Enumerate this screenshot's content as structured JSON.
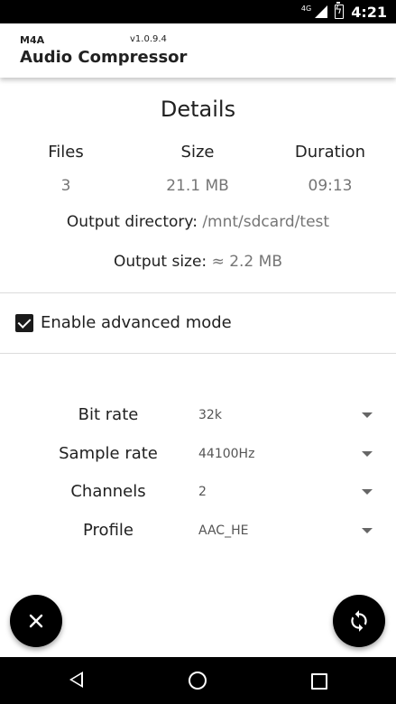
{
  "status_bar": {
    "network": "4G",
    "time": "4:21"
  },
  "app_bar": {
    "subtitle": "M4A",
    "version": "v1.0.9.4",
    "title": "Audio Compressor"
  },
  "details": {
    "heading": "Details",
    "stats": [
      {
        "label": "Files",
        "value": "3"
      },
      {
        "label": "Size",
        "value": "21.1 MB"
      },
      {
        "label": "Duration",
        "value": "09:13"
      }
    ],
    "output_directory_label": "Output directory:",
    "output_directory_value": "/mnt/sdcard/test",
    "output_size_label": "Output size:",
    "output_size_value": "≈ 2.2 MB"
  },
  "advanced": {
    "label": "Enable advanced mode",
    "checked": true
  },
  "settings": [
    {
      "label": "Bit rate",
      "value": "32k"
    },
    {
      "label": "Sample rate",
      "value": "44100Hz"
    },
    {
      "label": "Channels",
      "value": "2"
    },
    {
      "label": "Profile",
      "value": "AAC_HE"
    }
  ],
  "fabs": {
    "cancel_icon": "close-icon",
    "convert_icon": "sync-icon"
  },
  "colors": {
    "fab": "#000000",
    "status_bar": "#000000",
    "secondary_text": "#757575"
  }
}
